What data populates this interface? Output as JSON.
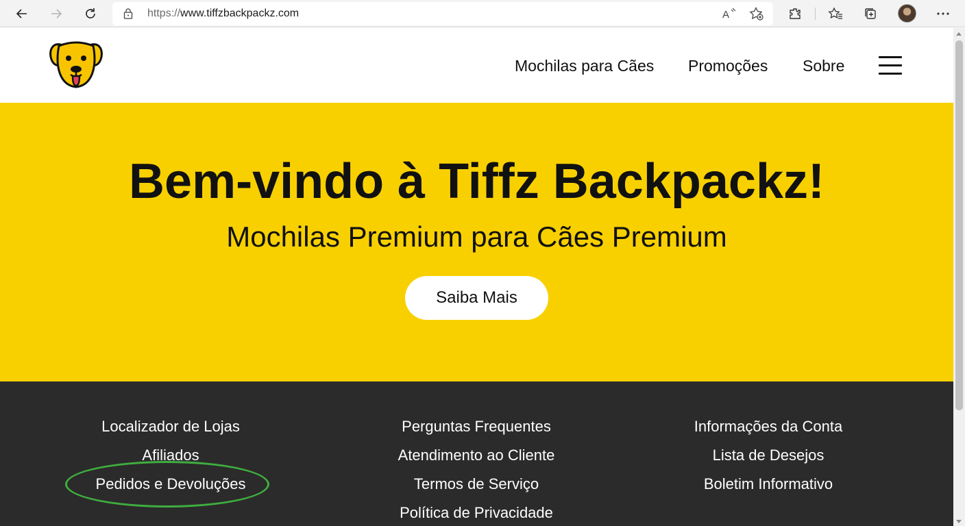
{
  "browser": {
    "url_protocol": "https://",
    "url_host": "www.tiffzbackpackz.com",
    "icons": {
      "back": "back-arrow-icon",
      "forward": "forward-arrow-icon",
      "refresh": "refresh-icon",
      "lock": "lock-icon",
      "read_aloud": "read-aloud-icon",
      "add_favorite": "add-favorite-icon",
      "extensions": "extensions-icon",
      "favorites": "favorites-icon",
      "collections": "collections-icon",
      "profile": "profile-avatar",
      "menu": "more-menu-icon"
    }
  },
  "header": {
    "logo": "dog-logo",
    "nav": [
      {
        "label": "Mochilas para Cães"
      },
      {
        "label": "Promoções"
      },
      {
        "label": "Sobre"
      }
    ],
    "menu_icon": "hamburger-menu-icon"
  },
  "hero": {
    "title": "Bem-vindo à Tiffz Backpackz!",
    "subtitle": "Mochilas Premium para Cães Premium",
    "cta_label": "Saiba Mais",
    "background_color": "#f8d000"
  },
  "footer": {
    "background_color": "#2b2b2b",
    "columns": [
      {
        "links": [
          "Localizador de Lojas",
          "Afiliados",
          "Pedidos e Devoluções"
        ]
      },
      {
        "links": [
          "Perguntas Frequentes",
          "Atendimento ao Cliente",
          "Termos de Serviço",
          "Política de Privacidade"
        ]
      },
      {
        "links": [
          "Informações da Conta",
          "Lista de Desejos",
          "Boletim Informativo"
        ]
      }
    ],
    "highlighted_link": "Pedidos e Devoluções",
    "highlight_color": "#3fae3f"
  }
}
